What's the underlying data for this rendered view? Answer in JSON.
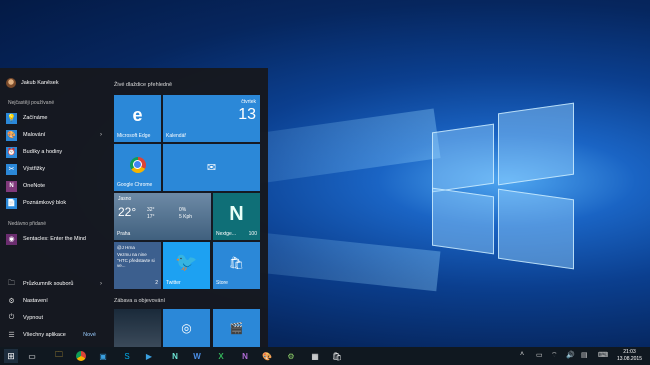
{
  "start": {
    "user": "Jakub Kaněsek",
    "most_used_header": "Nejčastěji používané",
    "apps": [
      {
        "label": "Začínáme",
        "icon": "lightbulb-icon",
        "color": "#2b88d8",
        "arrow": false
      },
      {
        "label": "Malování",
        "icon": "paint-icon",
        "color": "#2b88d8",
        "arrow": true
      },
      {
        "label": "Budíky a hodiny",
        "icon": "alarm-icon",
        "color": "#2b88d8",
        "arrow": false
      },
      {
        "label": "Výstřižky",
        "icon": "scissors-icon",
        "color": "#2b88d8",
        "arrow": false
      },
      {
        "label": "OneNote",
        "icon": "onenote-icon",
        "color": "#80397b",
        "arrow": false
      },
      {
        "label": "Poznámkový blok",
        "icon": "notepad-icon",
        "color": "#2b88d8",
        "arrow": false
      }
    ],
    "recent_header": "Nedávno přidané",
    "recent_app": "Sentacles: Enter the Mind",
    "system": [
      {
        "label": "Průzkumník souborů",
        "icon": "folder-icon",
        "arrow": true
      },
      {
        "label": "Nastavení",
        "icon": "gear-icon",
        "arrow": false
      },
      {
        "label": "Vypnout",
        "icon": "power-icon",
        "arrow": false
      },
      {
        "label": "Všechny aplikace",
        "icon": "list-icon",
        "arrow": false
      }
    ],
    "all_apps_badge": "Nové"
  },
  "tiles": {
    "group1": "Živé dlaždice přehledně",
    "group2": "Zábava a objevování",
    "edge": "Microsoft Edge",
    "calendar": {
      "label": "Kalendář",
      "day": "čtvrtek",
      "date": "13"
    },
    "chrome": "Google Chrome",
    "weather": {
      "city": "Jasno",
      "temp": "22°",
      "high": "32°",
      "low": "17°",
      "rain": "0%",
      "wind": "5 Kph",
      "place": "Praha"
    },
    "nextgen": {
      "label": "Nextge...",
      "count": "100"
    },
    "news": {
      "title": "@J Hrna",
      "text": "Vezmu na nine \"HTC představte si ve...",
      "count": "2"
    },
    "twitter": "Twitter",
    "store": "Store"
  },
  "taskbar": {
    "time": "21:03",
    "date": "13.08.2015"
  },
  "colors": {
    "accent": "#2b88d8",
    "startbg": "#16181e",
    "taskbar": "#101820"
  }
}
